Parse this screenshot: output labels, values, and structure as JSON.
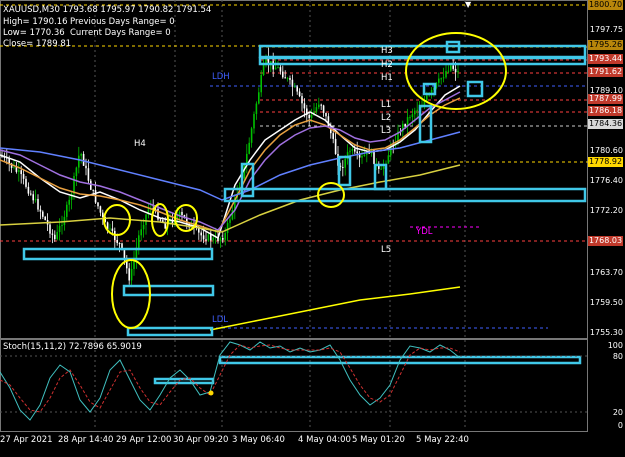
{
  "header": {
    "symbol_line": "XAUUSD,M30  1793.68 1795.97 1790.82 1791.54",
    "high_label": "High= 1790.16",
    "low_label": "Low= 1770.36",
    "close_label": "Close= 1789.81",
    "prev_range": "Previous Days Range= 0",
    "curr_range": "Current Days Range= 0"
  },
  "price_axis": {
    "ticks": [
      "1797.75",
      "1789.10",
      "1780.60",
      "1776.40",
      "1772.20",
      "1763.70",
      "1759.50",
      "1755.30"
    ],
    "boxes": [
      {
        "label": "1800.70",
        "color": "#b8860b",
        "text_color": "#000"
      },
      {
        "label": "1795.26",
        "color": "#b8860b",
        "text_color": "#000"
      },
      {
        "label": "1793.44",
        "color": "#c0392b",
        "text_color": "#fff"
      },
      {
        "label": "1791.62",
        "color": "#c0392b",
        "text_color": "#fff"
      },
      {
        "label": "1787.99",
        "color": "#c0392b",
        "text_color": "#fff"
      },
      {
        "label": "1786.18",
        "color": "#c0392b",
        "text_color": "#fff"
      },
      {
        "label": "1784.36",
        "color": "#d9d9d9",
        "text_color": "#000"
      },
      {
        "label": "1778.92",
        "color": "#ffd700",
        "text_color": "#000"
      },
      {
        "label": "1768.03",
        "color": "#c0392b",
        "text_color": "#fff"
      }
    ]
  },
  "levels": {
    "h3": "H3",
    "h2": "H2",
    "h1": "H1",
    "l1": "L1",
    "l2": "L2",
    "l3": "L3",
    "l5": "L5",
    "h4": "H4",
    "ydl": "YDL",
    "ldh": "LDH",
    "ldl": "LDL"
  },
  "stoch": {
    "label": "Stoch(15,11,2) 72.7896 65.9019",
    "ticks": [
      "100",
      "80",
      "20",
      "0"
    ]
  },
  "time_axis": [
    "27 Apr 2021",
    "28 Apr 14:40",
    "29 Apr 12:00",
    "30 Apr 09:20",
    "3 May 06:40",
    "4 May 04:00",
    "5 May 01:20",
    "5 May 22:40"
  ],
  "colors": {
    "bull": "#00c000",
    "bear": "#ffffff",
    "cyan": "#40c8e8",
    "yellow": "#ffff00",
    "ma_white": "#ffffff",
    "ma_orange": "#e8a040",
    "ma_purple": "#a070e0",
    "ma_blue": "#6080ff",
    "ydl": "#ff00ff",
    "stoch_main": "#40c0c0",
    "stoch_signal": "#d03030"
  }
}
